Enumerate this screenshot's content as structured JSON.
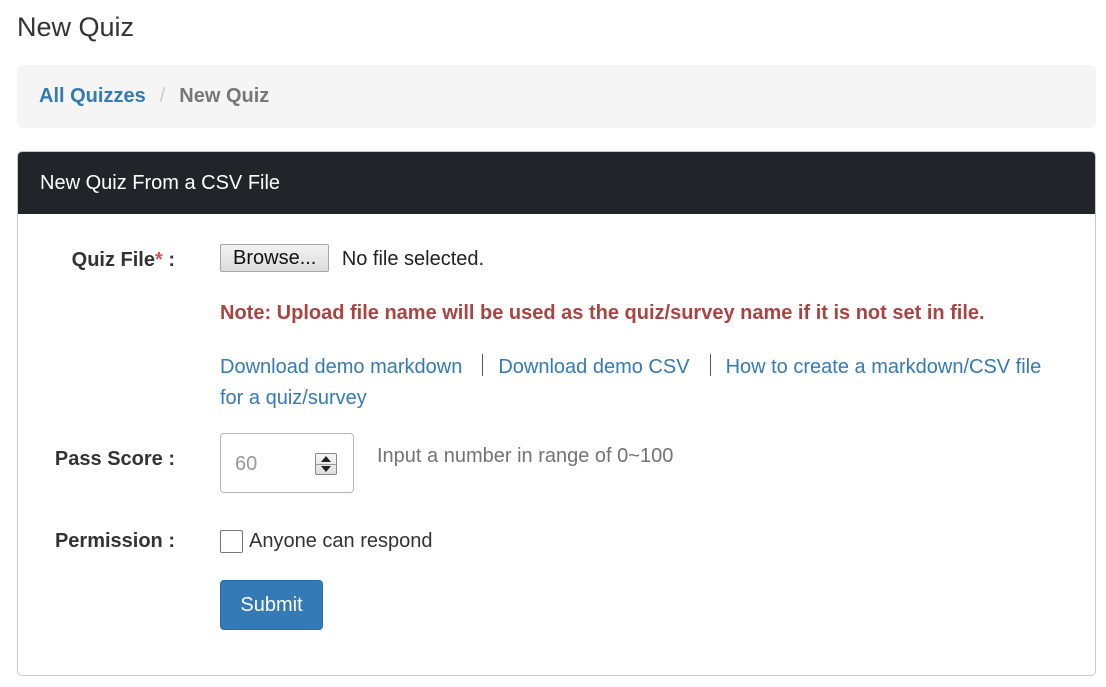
{
  "page": {
    "title": "New Quiz"
  },
  "breadcrumb": {
    "items": [
      {
        "label": "All Quizzes"
      },
      {
        "label": "New Quiz"
      }
    ],
    "separator": "/"
  },
  "panel": {
    "heading": "New Quiz From a CSV File"
  },
  "quiz_file": {
    "label": "Quiz File",
    "required_mark": "*",
    "colon": " :",
    "browse_label": "Browse...",
    "file_status": "No file selected."
  },
  "note": {
    "text": "Note: Upload file name will be used as the quiz/survey name if it is not set in file."
  },
  "links": {
    "demo_markdown": "Download demo markdown",
    "demo_csv": "Download demo CSV",
    "how_to": "How to create a markdown/CSV file for a quiz/survey"
  },
  "pass_score": {
    "label": "Pass Score :",
    "placeholder": "60",
    "help": "Input a number in range of 0~100"
  },
  "permission": {
    "label": "Permission :",
    "checkbox_label": "Anyone can respond",
    "checked": false
  },
  "submit": {
    "label": "Submit"
  },
  "colors": {
    "link": "#337ab7",
    "note": "#a94442",
    "heading_bg": "#212529",
    "primary_button": "#337ab7",
    "required": "#d9534f"
  },
  "icons": {
    "spinner_up": "chevron-up-icon",
    "spinner_down": "chevron-down-icon"
  }
}
